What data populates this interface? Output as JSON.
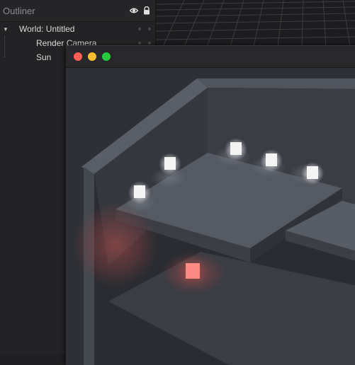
{
  "outliner": {
    "title": "Outliner",
    "world_label": "World: Untitled",
    "children": [
      {
        "label": "Render Camera"
      },
      {
        "label": "Sun"
      }
    ]
  },
  "icons": {
    "visibility": "eye-icon",
    "lock": "lock-icon",
    "expand": "caret-down-icon"
  },
  "window": {
    "controls": [
      "close",
      "minimize",
      "maximize"
    ]
  },
  "colors": {
    "close": "#fe5f57",
    "minimize": "#febb2e",
    "maximize": "#28c840",
    "light_white": "#ffffff",
    "light_red": "#ff6b6b"
  }
}
